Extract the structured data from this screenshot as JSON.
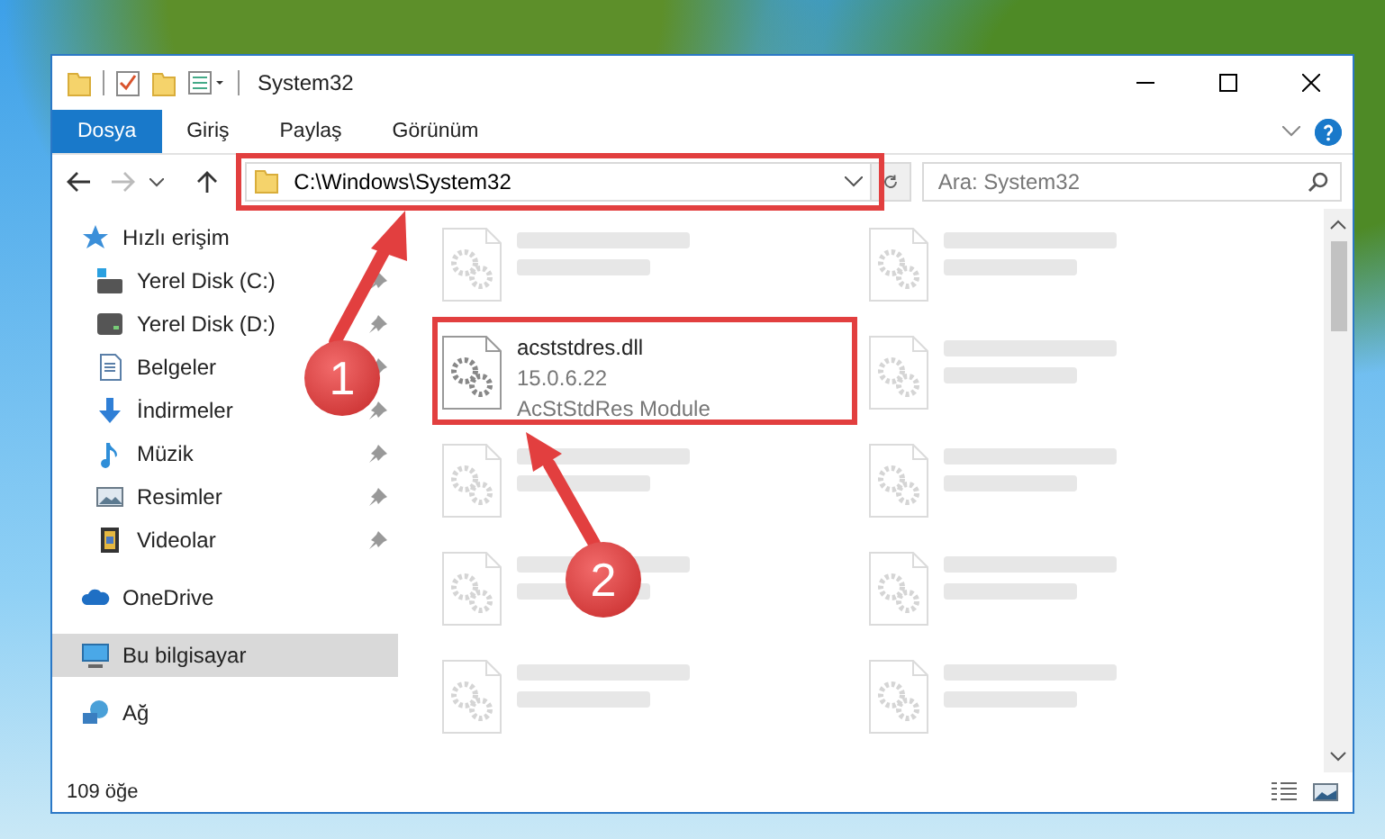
{
  "window": {
    "title": "System32"
  },
  "ribbon_tabs": [
    {
      "label": "Dosya",
      "selected": true
    },
    {
      "label": "Giriş",
      "selected": false
    },
    {
      "label": "Paylaş",
      "selected": false
    },
    {
      "label": "Görünüm",
      "selected": false
    }
  ],
  "address_bar": {
    "value": "C:\\Windows\\System32"
  },
  "search": {
    "placeholder": "Ara: System32"
  },
  "sidebar": {
    "items": [
      {
        "label": "Hızlı erişim",
        "kind": "star",
        "selected": false,
        "children": [
          {
            "label": "Yerel Disk (C:)",
            "kind": "system-drive",
            "pinned": true,
            "selected": false
          },
          {
            "label": "Yerel Disk (D:)",
            "kind": "drive",
            "pinned": true,
            "selected": false
          },
          {
            "label": "Belgeler",
            "kind": "document",
            "pinned": true,
            "selected": false
          },
          {
            "label": "İndirmeler",
            "kind": "download",
            "pinned": true,
            "selected": false
          },
          {
            "label": "Müzik",
            "kind": "music",
            "pinned": true,
            "selected": false
          },
          {
            "label": "Resimler",
            "kind": "picture",
            "pinned": true,
            "selected": false
          },
          {
            "label": "Videolar",
            "kind": "video",
            "pinned": true,
            "selected": false
          }
        ]
      },
      {
        "label": "OneDrive",
        "kind": "cloud",
        "selected": false
      },
      {
        "label": "Bu bilgisayar",
        "kind": "computer",
        "selected": true
      },
      {
        "label": "Ağ",
        "kind": "network",
        "selected": false
      }
    ]
  },
  "files": [
    {
      "blurred": true
    },
    {
      "blurred": true
    },
    {
      "name": "acststdres.dll",
      "lines": [
        "15.0.6.22",
        "AcStStdRes Module"
      ],
      "blurred": false
    },
    {
      "blurred": true
    },
    {
      "blurred": true
    },
    {
      "blurred": true
    },
    {
      "blurred": true
    },
    {
      "blurred": true
    },
    {
      "blurred": true
    },
    {
      "blurred": true
    }
  ],
  "status_bar": {
    "item_count": "109 öğe"
  },
  "annotations": [
    {
      "number": "1"
    },
    {
      "number": "2"
    }
  ]
}
